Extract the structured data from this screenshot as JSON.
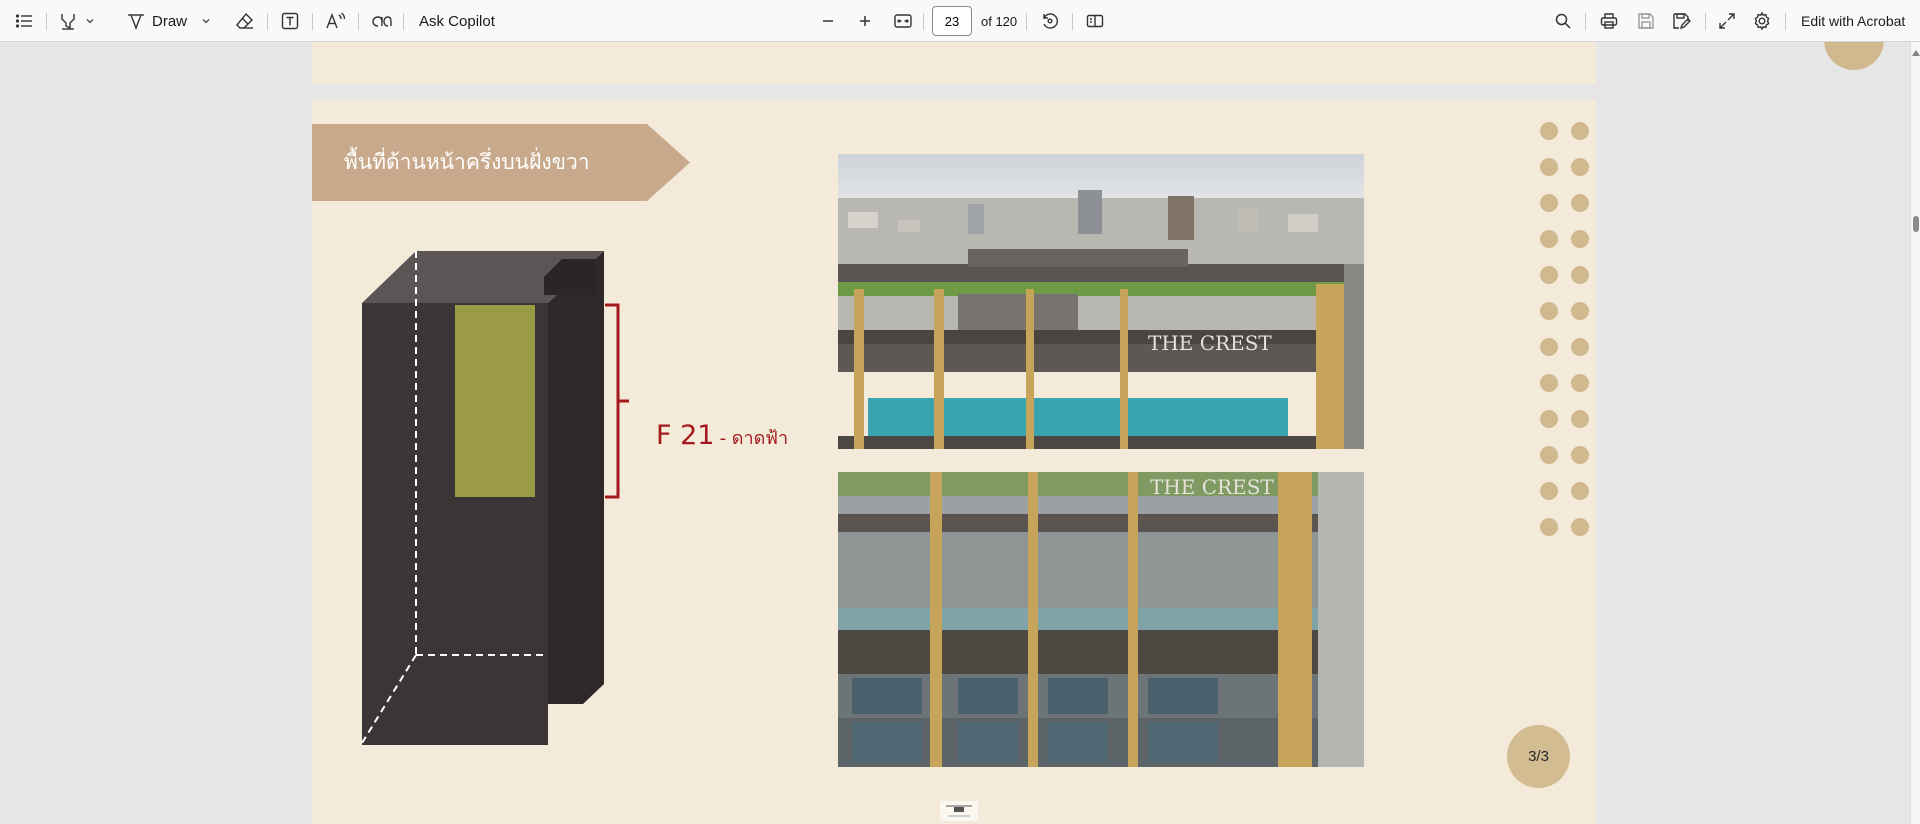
{
  "toolbar": {
    "draw_label": "Draw",
    "ask_copilot_label": "Ask Copilot",
    "page_number": "23",
    "page_total": "of 120",
    "edit_label": "Edit with Acrobat"
  },
  "page": {
    "banner_title": "พื้นที่ด้านหน้าครึ่งบนฝั่งขวา",
    "floor_code": "F 21",
    "floor_name": "- ดาดฟ้า",
    "page_indicator": "3/3",
    "photo_top_sign": "THE CREST",
    "photo_bottom_sign": "THE CREST"
  },
  "colors": {
    "page_background": "#f3ead9",
    "banner": "#c8a98b",
    "building_dark": "#3b3536",
    "highlight_area": "#9b9a45",
    "label_red": "#a4191d",
    "dots": "#d0b98e"
  },
  "icons": {
    "contents": "list-icon",
    "highlight": "highlighter-icon",
    "draw": "pen-icon",
    "erase": "eraser-icon",
    "text": "text-box-icon",
    "read_aloud": "read-aloud-icon",
    "translate": "translate-icon",
    "zoom_out": "minus-icon",
    "zoom_in": "plus-icon",
    "fit": "fit-page-icon",
    "rotate": "rotate-icon",
    "page_view": "page-view-icon",
    "search": "search-icon",
    "print": "print-icon",
    "save": "save-icon",
    "save_as": "save-as-icon",
    "fullscreen": "fullscreen-icon",
    "settings": "gear-icon"
  }
}
